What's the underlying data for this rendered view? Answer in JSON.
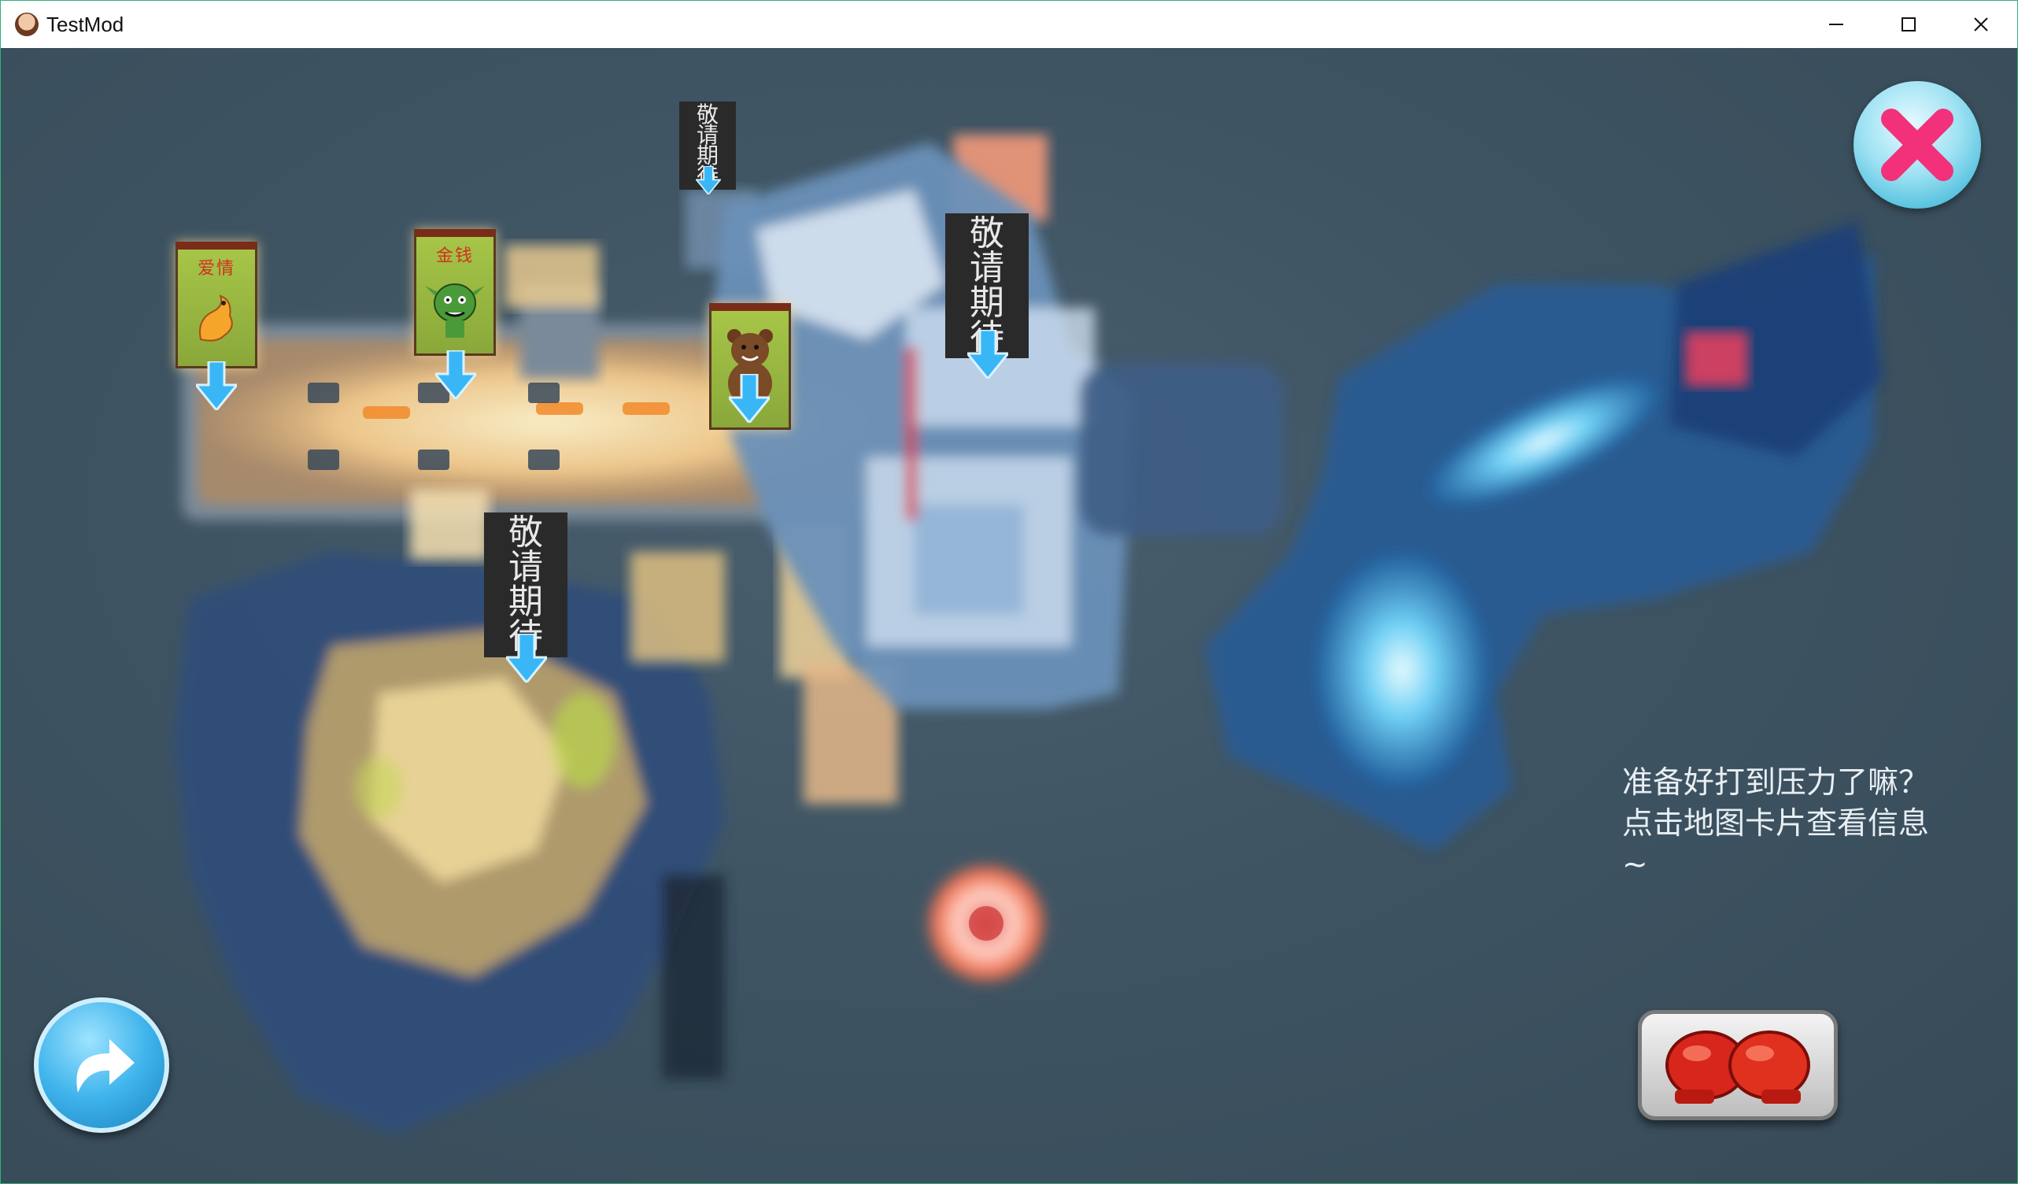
{
  "window": {
    "title": "TestMod"
  },
  "window_controls": {
    "minimize": "minimize-icon",
    "maximize": "maximize-icon",
    "close": "close-icon"
  },
  "map": {
    "cards": [
      {
        "label": "爱情",
        "creature": "dragon"
      },
      {
        "label": "金钱",
        "creature": "goblin"
      },
      {
        "label": "",
        "creature": "bear"
      }
    ],
    "coming_soon": [
      {
        "chars": [
          "敬",
          "请",
          "期",
          "待"
        ]
      },
      {
        "chars": [
          "敬",
          "请",
          "期",
          "待"
        ]
      },
      {
        "chars": [
          "敬",
          "请",
          "期",
          "待"
        ]
      }
    ]
  },
  "hint_text": "准备好打到压力了嘛？ 点击地图卡片查看信息~",
  "buttons": {
    "close": "close-x-icon",
    "back": "redo-arrow-icon",
    "fight": "boxing-gloves-icon"
  },
  "colors": {
    "background": "#3f5564",
    "glow": "#ffd9a0",
    "water": "#2a6fb0",
    "arrow": "#39b6f5",
    "titlebar_border": "#2fb37a"
  }
}
